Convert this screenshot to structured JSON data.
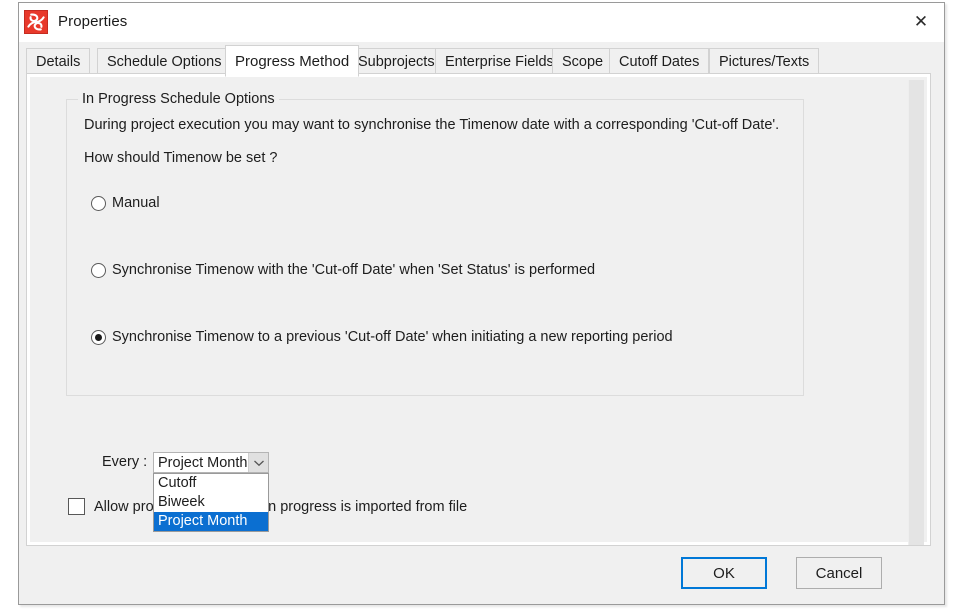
{
  "window": {
    "title": "Properties",
    "icon": "app-logo-icon",
    "close_icon": "close-icon"
  },
  "tabs": [
    {
      "label": "Details",
      "active": false
    },
    {
      "label": "Schedule Options",
      "active": false
    },
    {
      "label": "Progress Method",
      "active": true
    },
    {
      "label": "Subprojects",
      "active": false
    },
    {
      "label": "Enterprise Fields",
      "active": false
    },
    {
      "label": "Scope",
      "active": false
    },
    {
      "label": "Cutoff Dates",
      "active": false
    },
    {
      "label": "Pictures/Texts",
      "active": false
    }
  ],
  "groupbox": {
    "title": "In Progress Schedule Options",
    "description": "During project execution you may want to synchronise the Timenow date with a corresponding 'Cut-off Date'.",
    "question": "How should Timenow be set ?"
  },
  "radios": [
    {
      "label": "Manual",
      "checked": false
    },
    {
      "label": "Synchronise Timenow with the 'Cut-off Date' when 'Set Status' is performed",
      "checked": false
    },
    {
      "label": "Synchronise Timenow to a previous 'Cut-off Date' when initiating a new reporting period",
      "checked": true
    }
  ],
  "every": {
    "label": "Every :",
    "selected_value": "Project Month",
    "expanded": true,
    "options": [
      {
        "label": "Cutoff",
        "selected": false
      },
      {
        "label": "Biweek",
        "selected": false
      },
      {
        "label": "Project Month",
        "selected": true
      }
    ]
  },
  "checkbox": {
    "label": "Allow progress update when progress is imported from file",
    "checked": false
  },
  "footer": {
    "ok_label": "OK",
    "cancel_label": "Cancel"
  },
  "colors": {
    "accent": "#0078d7",
    "selection": "#0b6fd1",
    "app_icon": "#e8392b",
    "window_bg": "#f0f0f0",
    "panel_bg": "#ffffff"
  }
}
